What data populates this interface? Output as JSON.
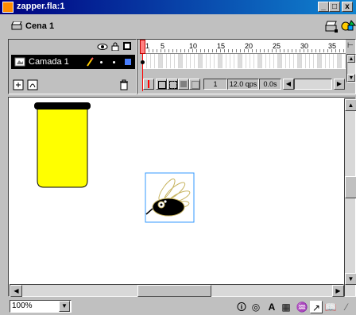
{
  "window": {
    "title": "zapper.fla:1",
    "minimize_label": "_",
    "maximize_label": "□",
    "close_label": "x"
  },
  "scene": {
    "label": "Cena 1"
  },
  "timeline": {
    "ruler_ticks": [
      "1",
      "5",
      "10",
      "15",
      "20",
      "25",
      "30",
      "35"
    ],
    "layer": {
      "name": "Camada 1",
      "color": "#4a7fff"
    },
    "current_frame": "1",
    "frame_rate": "12.0 qps",
    "elapsed_time": "0.0s"
  },
  "stage": {
    "jar_color": "#ffff00",
    "jar_lid_color": "#000000",
    "selection_color": "#3399ff"
  },
  "statusbar": {
    "zoom": "100%"
  }
}
